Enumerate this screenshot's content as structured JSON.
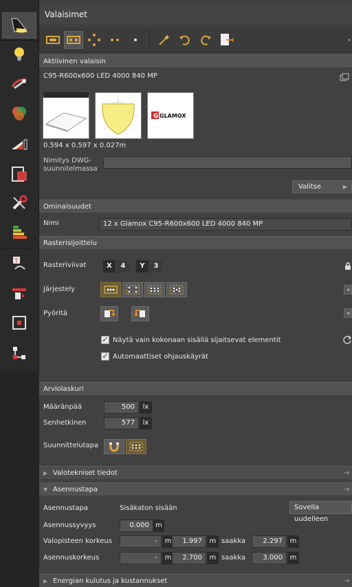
{
  "left_toolbar": {
    "items": [
      {
        "icon": "lamp-icon",
        "active": true
      },
      {
        "icon": "lightbulb-icon"
      },
      {
        "icon": "light-settings-icon"
      },
      {
        "icon": "color-circles-icon"
      },
      {
        "icon": "measure-icon"
      },
      {
        "icon": "room-layout-icon"
      },
      {
        "icon": "tools-icon"
      },
      {
        "icon": "energy-bars-icon"
      },
      {
        "icon": "text-curve-icon"
      },
      {
        "icon": "insert-symbol-icon"
      },
      {
        "icon": "frame-target-icon"
      },
      {
        "icon": "hierarchy-icon"
      }
    ]
  },
  "panel": {
    "title": "Valaisimet"
  },
  "active_luminaire": {
    "header": "Aktiivinen valaisin",
    "name": "C95-R600x600 LED 4000 840 MP",
    "dimensions": "0.594 x 0.597 x 0.027m",
    "brand_logo": "GLAMOX",
    "dwg_label_line1": "Nimitys DWG-",
    "dwg_label_line2": "suunnitelmassa",
    "dwg_value": "",
    "select_button": "Valitse"
  },
  "properties": {
    "header": "Ominaisuudet",
    "name_label": "Nimi",
    "name_value": "12 x Glamox C95-R600x600 LED 4000 840 MP"
  },
  "grid": {
    "header": "Rasterisijoittelu",
    "lines_label": "Rasteriviivat",
    "x_label": "X",
    "x_value": "4",
    "y_label": "Y",
    "y_value": "3",
    "arrangement_label": "Järjestely",
    "rotate_label": "Pyöritä",
    "cb1_label": "Näytä vain kokonaan sisällä sijaitsevat elementit",
    "cb1_checked": true,
    "cb2_label": "Automaattiset ohjauskäyrät",
    "cb2_checked": true
  },
  "calculator": {
    "header": "Arviolaskuri",
    "target_label": "Määränpää",
    "target_value": "500",
    "target_unit": "lx",
    "current_label": "Senhetkinen",
    "current_value": "577",
    "current_unit": "lx",
    "method_label": "Suunnittelutapa"
  },
  "photometric": {
    "header": "Valotekniset tiedot"
  },
  "installation": {
    "header": "Asennustapa",
    "type_label": "Asennustapa",
    "type_value": "Sisäkaton sisään",
    "reapply_button": "Sovella uudelleen",
    "depth_label": "Asennussyvyys",
    "depth_value": "0.000",
    "depth_unit": "m",
    "point_height_label": "Valopisteen korkeus",
    "point_height_value": "-",
    "point_height_unit": "m",
    "point_height_from": "1.997",
    "point_height_from_unit": "m",
    "to_word": "saakka",
    "point_height_to": "2.297",
    "point_height_to_unit": "m",
    "mount_height_label": "Asennuskorkeus",
    "mount_height_value": "-",
    "mount_height_unit": "m",
    "mount_height_from": "2.700",
    "mount_height_from_unit": "m",
    "mount_height_to_word": "saakka",
    "mount_height_to": "3.000",
    "mount_height_to_unit": "m"
  },
  "energy": {
    "header": "Energian kulutus ja kustannukset"
  },
  "colors": {
    "accent": "#c8a53a",
    "panel_bg": "#414141",
    "header_bg": "#525252"
  }
}
